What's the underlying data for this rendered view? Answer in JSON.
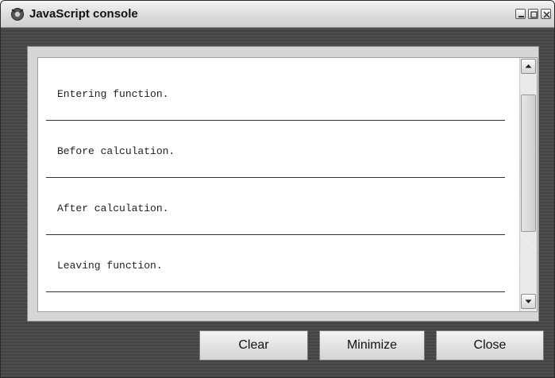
{
  "window": {
    "title": "JavaScript console",
    "icons": {
      "app": "console-icon",
      "minimize": "minimize-icon",
      "maximize": "maximize-icon",
      "close": "close-icon"
    }
  },
  "console": {
    "entries": [
      {
        "text": "Entering function."
      },
      {
        "text": "Before calculation."
      },
      {
        "text": "After calculation."
      },
      {
        "text": "Leaving function."
      }
    ],
    "scrollbar": {
      "up_icon": "arrow-up-icon",
      "down_icon": "arrow-down-icon"
    }
  },
  "buttons": {
    "clear": "Clear",
    "minimize": "Minimize",
    "close": "Close"
  }
}
